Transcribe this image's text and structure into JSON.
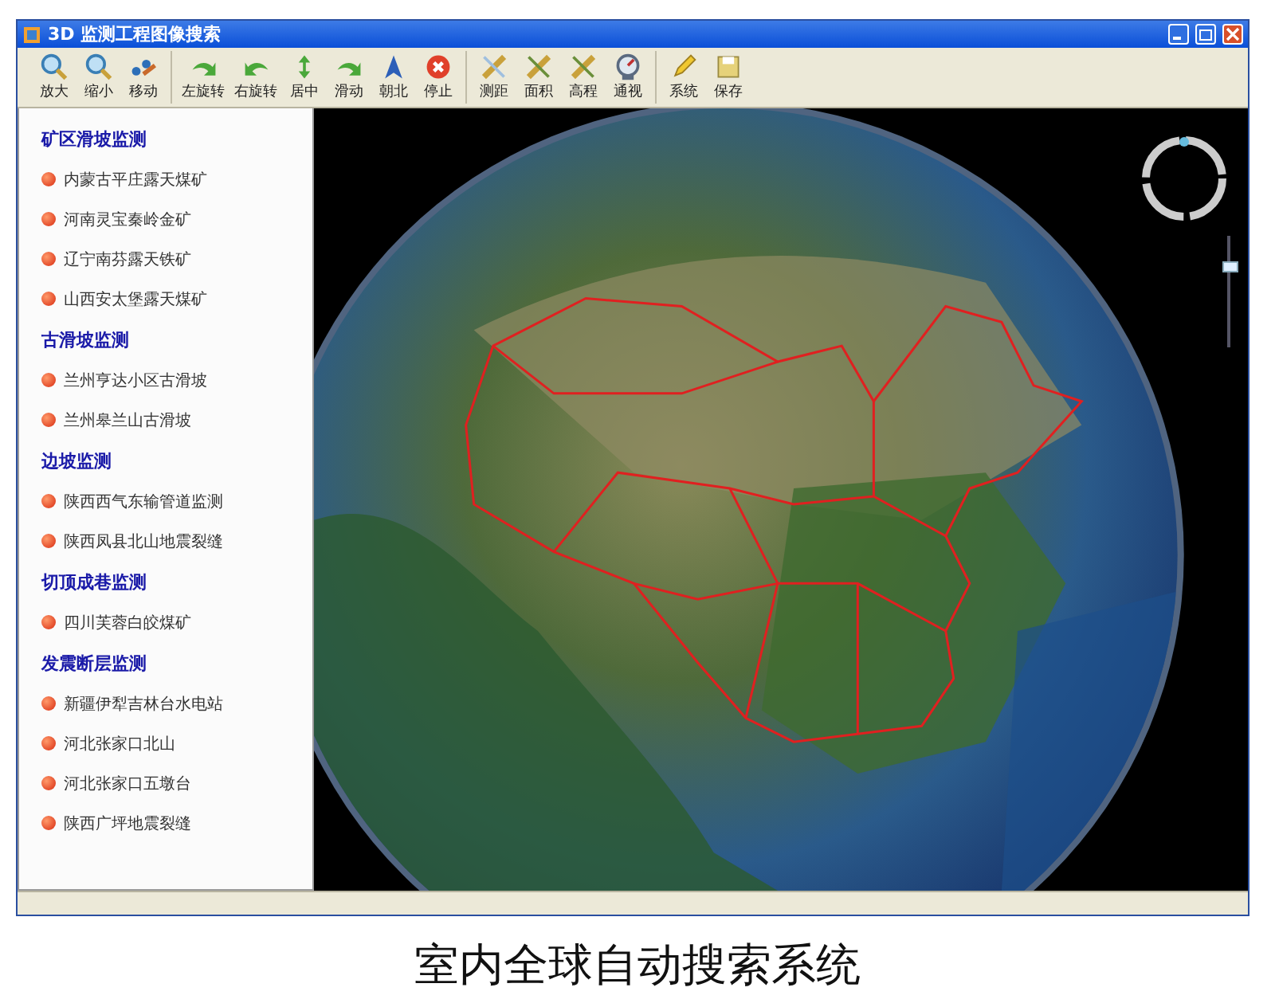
{
  "window": {
    "title": "3D 监测工程图像搜索"
  },
  "toolbar": {
    "groups": [
      [
        "放大",
        "缩小",
        "移动"
      ],
      [
        "左旋转",
        "右旋转",
        "居中",
        "滑动",
        "朝北",
        "停止"
      ],
      [
        "测距",
        "面积",
        "高程",
        "通视"
      ],
      [
        "系统",
        "保存"
      ]
    ]
  },
  "sidebar": {
    "groups": [
      {
        "title": "矿区滑坡监测",
        "items": [
          "内蒙古平庄露天煤矿",
          "河南灵宝秦岭金矿",
          "辽宁南芬露天铁矿",
          "山西安太堡露天煤矿"
        ]
      },
      {
        "title": "古滑坡监测",
        "items": [
          "兰州亨达小区古滑坡",
          "兰州皋兰山古滑坡"
        ]
      },
      {
        "title": "边坡监测",
        "items": [
          "陕西西气东输管道监测",
          "陕西凤县北山地震裂缝"
        ]
      },
      {
        "title": "切顶成巷监测",
        "items": [
          "四川芙蓉白皎煤矿"
        ]
      },
      {
        "title": "发震断层监测",
        "items": [
          "新疆伊犁吉林台水电站",
          "河北张家口北山",
          "河北张家口五墩台",
          "陕西广坪地震裂缝"
        ]
      }
    ]
  },
  "map": {
    "zoom_slider": {
      "level": 0.75
    }
  },
  "caption": "室内全球自动搜索系统"
}
